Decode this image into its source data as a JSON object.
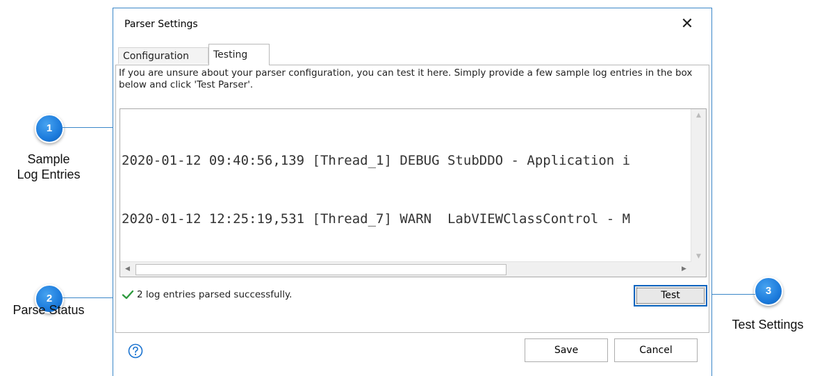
{
  "dialog": {
    "title": "Parser Settings",
    "close_symbol": "✕",
    "tabs": [
      {
        "label": "Configuration",
        "active": false
      },
      {
        "label": "Testing",
        "active": true
      }
    ],
    "instructions": "If you are unsure about your parser configuration, you can test it here.  Simply provide a few sample log entries in the box below and click 'Test Parser'.",
    "log_entries": [
      "2020-01-12 09:40:56,139 [Thread_1] DEBUG StubDDO - Application i",
      "2020-01-12 12:25:19,531 [Thread_7] WARN  LabVIEWClassControl - M"
    ],
    "status_text": "2 log entries parsed successfully.",
    "test_button_label": "Test",
    "save_button_label": "Save",
    "cancel_button_label": "Cancel",
    "help_icon": "help-icon",
    "colors": {
      "accent": "#0a65c0",
      "success": "#2e9a3e",
      "callout": "#1c7bdc"
    }
  },
  "callouts": [
    {
      "number": "1",
      "label_line1": "Sample",
      "label_line2": "Log Entries"
    },
    {
      "number": "2",
      "label": "Parse Status"
    },
    {
      "number": "3",
      "label": "Test Settings"
    }
  ]
}
